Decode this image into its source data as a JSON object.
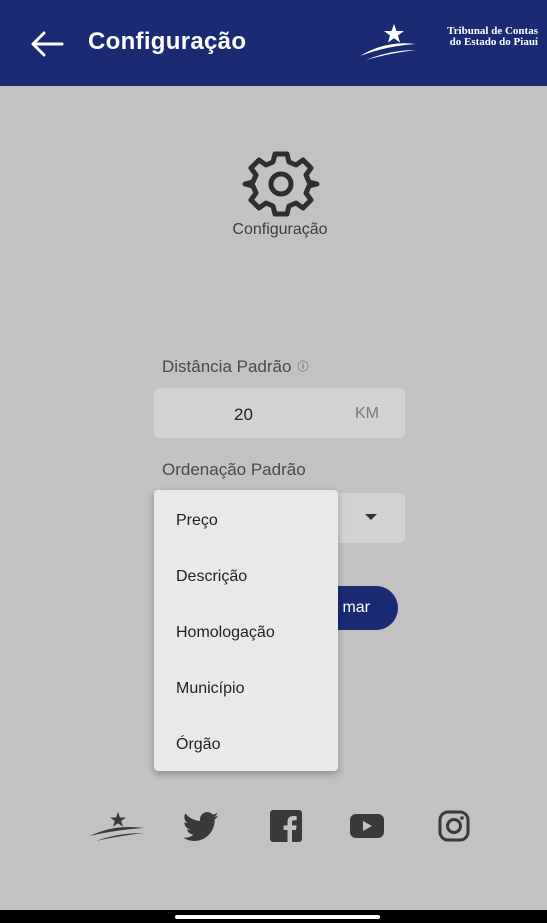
{
  "app_bar": {
    "title": "Configuração",
    "back_icon": "arrow-left-icon",
    "brand_line1": "Tribunal de Contas",
    "brand_line2": "do Estado do Piauí",
    "background": "#1a2b73"
  },
  "header": {
    "icon": "gear-icon",
    "caption": "Configuração"
  },
  "settings": {
    "distance_label": "Distância Padrão",
    "distance_info_icon": "ⓘ",
    "distance_value": "20",
    "distance_unit": "KM",
    "order_label": "Ordenação Padrão",
    "order_selected": ""
  },
  "confirm_button": {
    "label": "mar"
  },
  "order_dropdown": {
    "options": [
      "Preço",
      "Descrição",
      "Homologação",
      "Município",
      "Órgão"
    ]
  },
  "footer": {
    "icons": [
      "tce-logo-icon",
      "twitter-icon",
      "facebook-icon",
      "youtube-icon",
      "instagram-icon"
    ]
  },
  "colors": {
    "primary": "#1a2b73",
    "overlay_background": "#c2c2c2",
    "menu_background": "#e9e9e9"
  }
}
